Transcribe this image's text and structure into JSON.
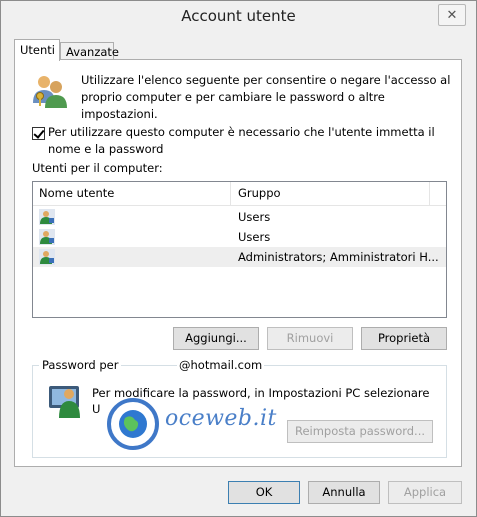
{
  "window": {
    "title": "Account utente",
    "close_glyph": "✕"
  },
  "tabs": [
    {
      "label": "Utenti"
    },
    {
      "label": "Avanzate"
    }
  ],
  "intro": {
    "text": "Utilizzare l'elenco seguente per consentire o negare l'accesso al proprio computer e per cambiare le password o altre impostazioni."
  },
  "require_login": {
    "checked": true,
    "label": "Per utilizzare questo computer è necessario che l'utente immetta il nome e la password"
  },
  "users_heading": "Utenti per il computer:",
  "users_table": {
    "columns": [
      "Nome utente",
      "Gruppo"
    ],
    "rows": [
      {
        "name": "",
        "group": "Users"
      },
      {
        "name": "",
        "group": "Users"
      },
      {
        "name": "",
        "group": "Administrators; Amministratori H..."
      }
    ]
  },
  "actions": {
    "add": "Aggiungi...",
    "remove": "Rimuovi",
    "properties": "Proprietà"
  },
  "password_group": {
    "title": "Password per",
    "email": "@hotmail.com",
    "text": "Per modificare la password, in Impostazioni PC selezionare U",
    "reset": "Reimposta password..."
  },
  "watermark": {
    "text": "oceweb.it"
  },
  "footer": {
    "ok": "OK",
    "cancel": "Annulla",
    "apply": "Applica"
  },
  "colors": {
    "accent": "#3c7fb1",
    "watermark": "#4a7fc8",
    "selection": "#eeeeee"
  }
}
